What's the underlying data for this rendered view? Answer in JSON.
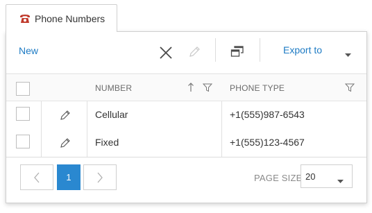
{
  "tab": {
    "label": "Phone Numbers",
    "icon": "phone-icon",
    "icon_color": "#c0392b"
  },
  "toolbar": {
    "new_label": "New",
    "export_label": "Export to",
    "accent": "#1e7bc4"
  },
  "grid": {
    "columns": [
      "NUMBER",
      "PHONE TYPE"
    ],
    "rows": [
      {
        "number": "Cellular",
        "type": "+1(555)987-6543"
      },
      {
        "number": "Fixed",
        "type": "+1(555)123-4567"
      }
    ]
  },
  "pager": {
    "current_page": "1",
    "page_size_label": "PAGE SIZE",
    "page_size_value": "20",
    "active_color": "#2a88d0"
  }
}
